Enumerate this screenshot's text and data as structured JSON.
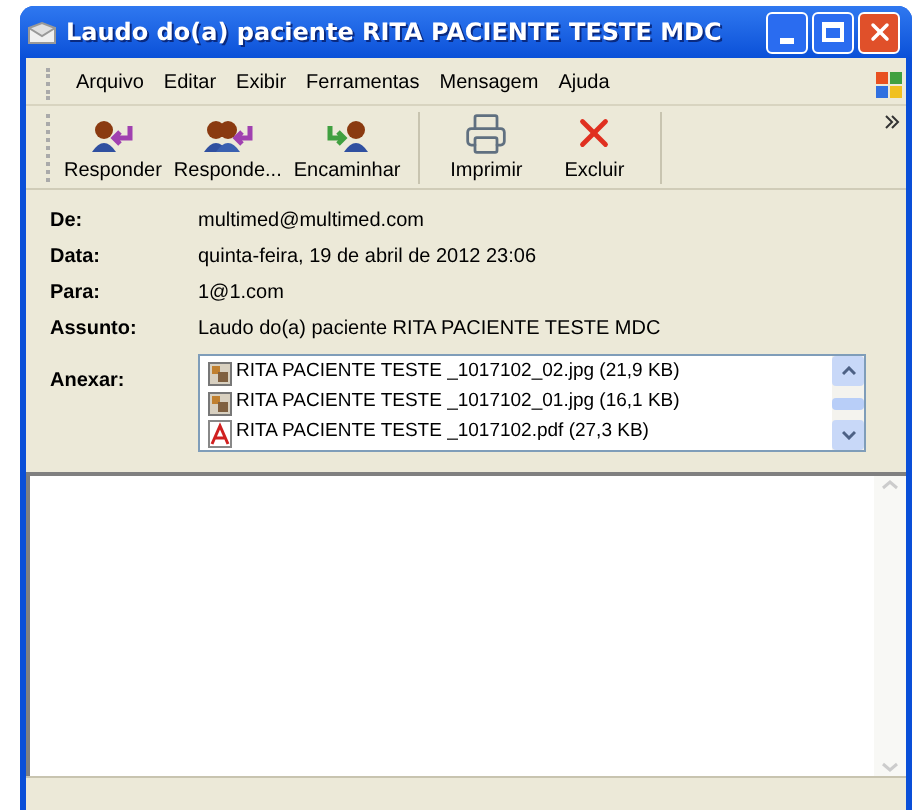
{
  "window": {
    "title": "Laudo do(a) paciente RITA PACIENTE TESTE MDC"
  },
  "menu": [
    "Arquivo",
    "Editar",
    "Exibir",
    "Ferramentas",
    "Mensagem",
    "Ajuda"
  ],
  "toolbar": [
    {
      "kind": "reply",
      "label": "Responder"
    },
    {
      "kind": "reply_all",
      "label": "Responde..."
    },
    {
      "kind": "forward",
      "label": "Encaminhar"
    },
    {
      "kind": "print",
      "label": "Imprimir"
    },
    {
      "kind": "delete",
      "label": "Excluir"
    }
  ],
  "headers": [
    {
      "label": "De:",
      "value": "multimed@multimed.com"
    },
    {
      "label": "Data:",
      "value": "quinta-feira, 19 de abril de 2012 23:06"
    },
    {
      "label": "Para:",
      "value": "1@1.com"
    },
    {
      "label": "Assunto:",
      "value": "Laudo do(a) paciente RITA PACIENTE TESTE MDC"
    }
  ],
  "attachments": {
    "label": "Anexar:",
    "files": [
      {
        "kind": "image",
        "name": "RITA PACIENTE TESTE _1017102_02.jpg (21,9 KB)"
      },
      {
        "kind": "image",
        "name": "RITA PACIENTE TESTE _1017102_01.jpg (16,1 KB)"
      },
      {
        "kind": "pdf",
        "name": "RITA PACIENTE TESTE _1017102.pdf (27,3 KB)"
      }
    ]
  }
}
